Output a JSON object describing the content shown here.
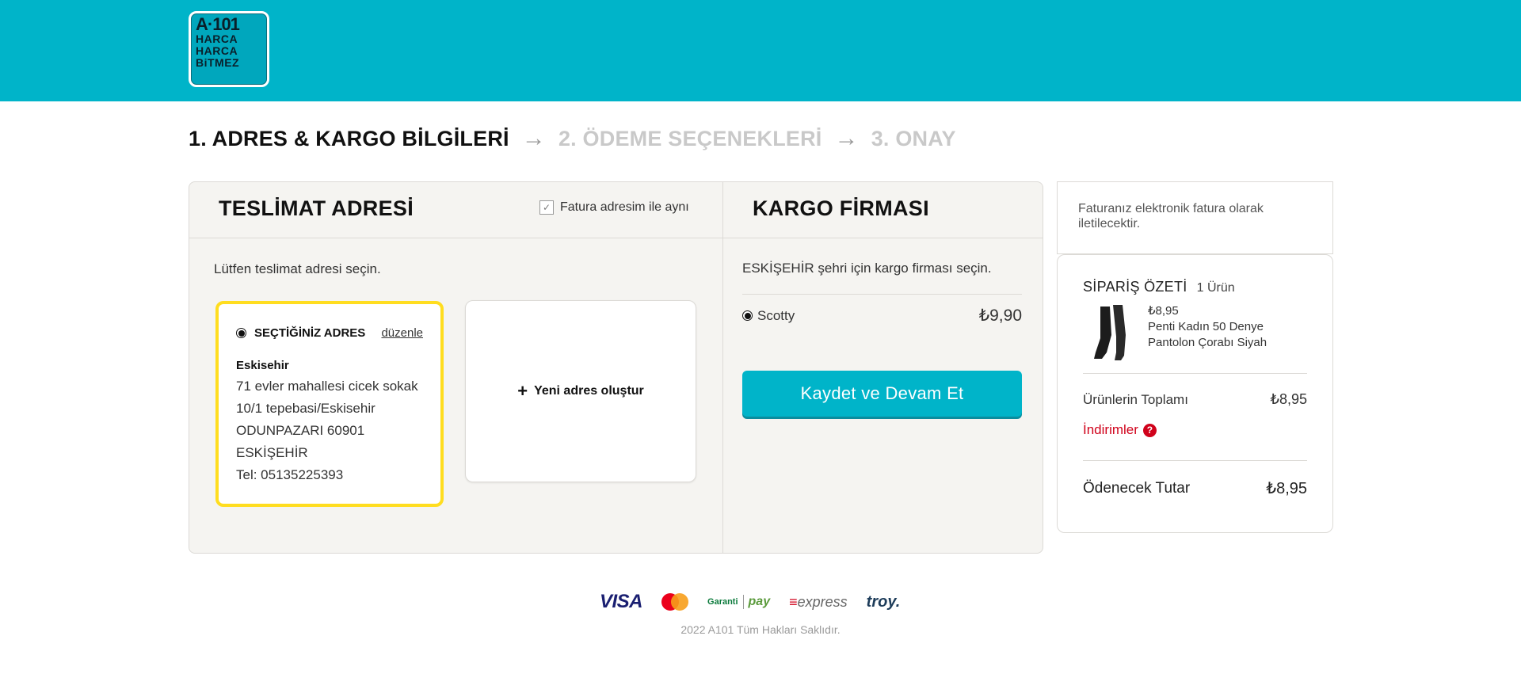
{
  "brand": {
    "logo_lines": [
      "A·101",
      "HARCA",
      "HARCA",
      "BiTMEZ"
    ]
  },
  "steps": [
    {
      "label": "1. ADRES & KARGO BİLGİLERİ",
      "active": true
    },
    {
      "label": "2. ÖDEME SEÇENEKLERİ",
      "active": false
    },
    {
      "label": "3. ONAY",
      "active": false
    }
  ],
  "delivery": {
    "title": "TESLİMAT ADRESİ",
    "same_invoice_label": "Fatura adresim ile aynı",
    "same_invoice_checked": true,
    "hint": "Lütfen teslimat adresi seçin.",
    "selected_address": {
      "label": "SEÇTİĞİNİZ ADRES",
      "edit_label": "düzenle",
      "name": "Eskisehir",
      "lines": [
        "71 evler mahallesi cicek sokak",
        "10/1 tepebasi/Eskisehir",
        "ODUNPAZARI 60901",
        "ESKİŞEHİR",
        "Tel: 05135225393"
      ]
    },
    "new_address_label": "Yeni adres oluştur"
  },
  "cargo": {
    "title": "KARGO FİRMASI",
    "hint": "ESKİŞEHİR şehri için kargo firması seçin.",
    "option_name": "Scotty",
    "option_price": "₺9,90",
    "save_label": "Kaydet ve Devam Et"
  },
  "einvoice_text": "Faturanız elektronik fatura olarak iletilecektir.",
  "summary": {
    "title": "SİPARİŞ ÖZETİ",
    "count": "1 Ürün",
    "product_price": "₺8,95",
    "product_name_line1": "Penti Kadın 50 Denye",
    "product_name_line2": "Pantolon Çorabı Siyah",
    "subtotal_label": "Ürünlerin Toplamı",
    "subtotal_value": "₺8,95",
    "discounts_label": "İndirimler",
    "total_label": "Ödenecek Tutar",
    "total_value": "₺8,95"
  },
  "payments": {
    "visa": "VISA",
    "mastercard": "MasterCard",
    "garanti": "Garanti",
    "garanti_pay": "pay",
    "express_mark": "≡",
    "express": "express",
    "troy": "troy."
  },
  "footer": {
    "copyright": "2022 A101 Tüm Hakları Saklıdır."
  },
  "colors": {
    "header": "#00b4c9",
    "selected_border": "#ffdd1f",
    "discount": "#d0021b"
  },
  "icons": {
    "check": "check-icon",
    "plus": "plus-icon",
    "question": "question-icon",
    "arrow": "arrow-right-icon"
  }
}
